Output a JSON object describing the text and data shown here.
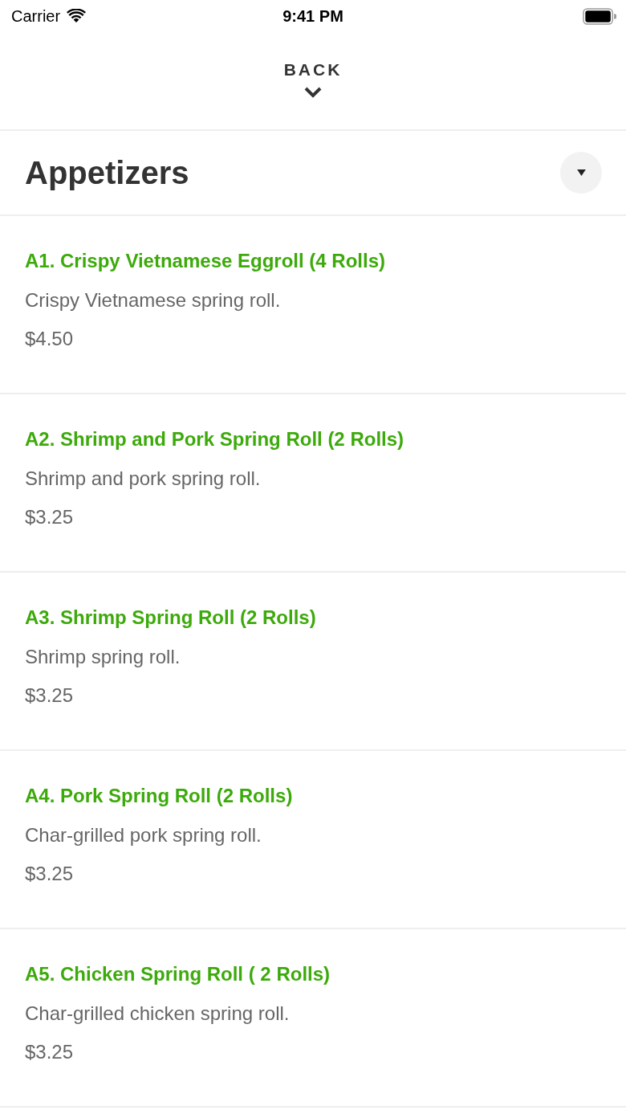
{
  "status_bar": {
    "carrier": "Carrier",
    "time": "9:41 PM"
  },
  "header": {
    "back_label": "BACK"
  },
  "section": {
    "title": "Appetizers"
  },
  "items": [
    {
      "name": "A1. Crispy Vietnamese Eggroll (4 Rolls)",
      "description": "Crispy Vietnamese spring roll.",
      "price": "$4.50"
    },
    {
      "name": "A2. Shrimp and Pork Spring Roll (2 Rolls)",
      "description": "Shrimp and pork spring roll.",
      "price": "$3.25"
    },
    {
      "name": "A3. Shrimp Spring Roll (2 Rolls)",
      "description": "Shrimp spring roll.",
      "price": "$3.25"
    },
    {
      "name": "A4. Pork Spring Roll (2 Rolls)",
      "description": "Char-grilled pork spring roll.",
      "price": "$3.25"
    },
    {
      "name": "A5. Chicken Spring Roll ( 2 Rolls)",
      "description": "Char-grilled chicken spring roll.",
      "price": "$3.25"
    }
  ]
}
